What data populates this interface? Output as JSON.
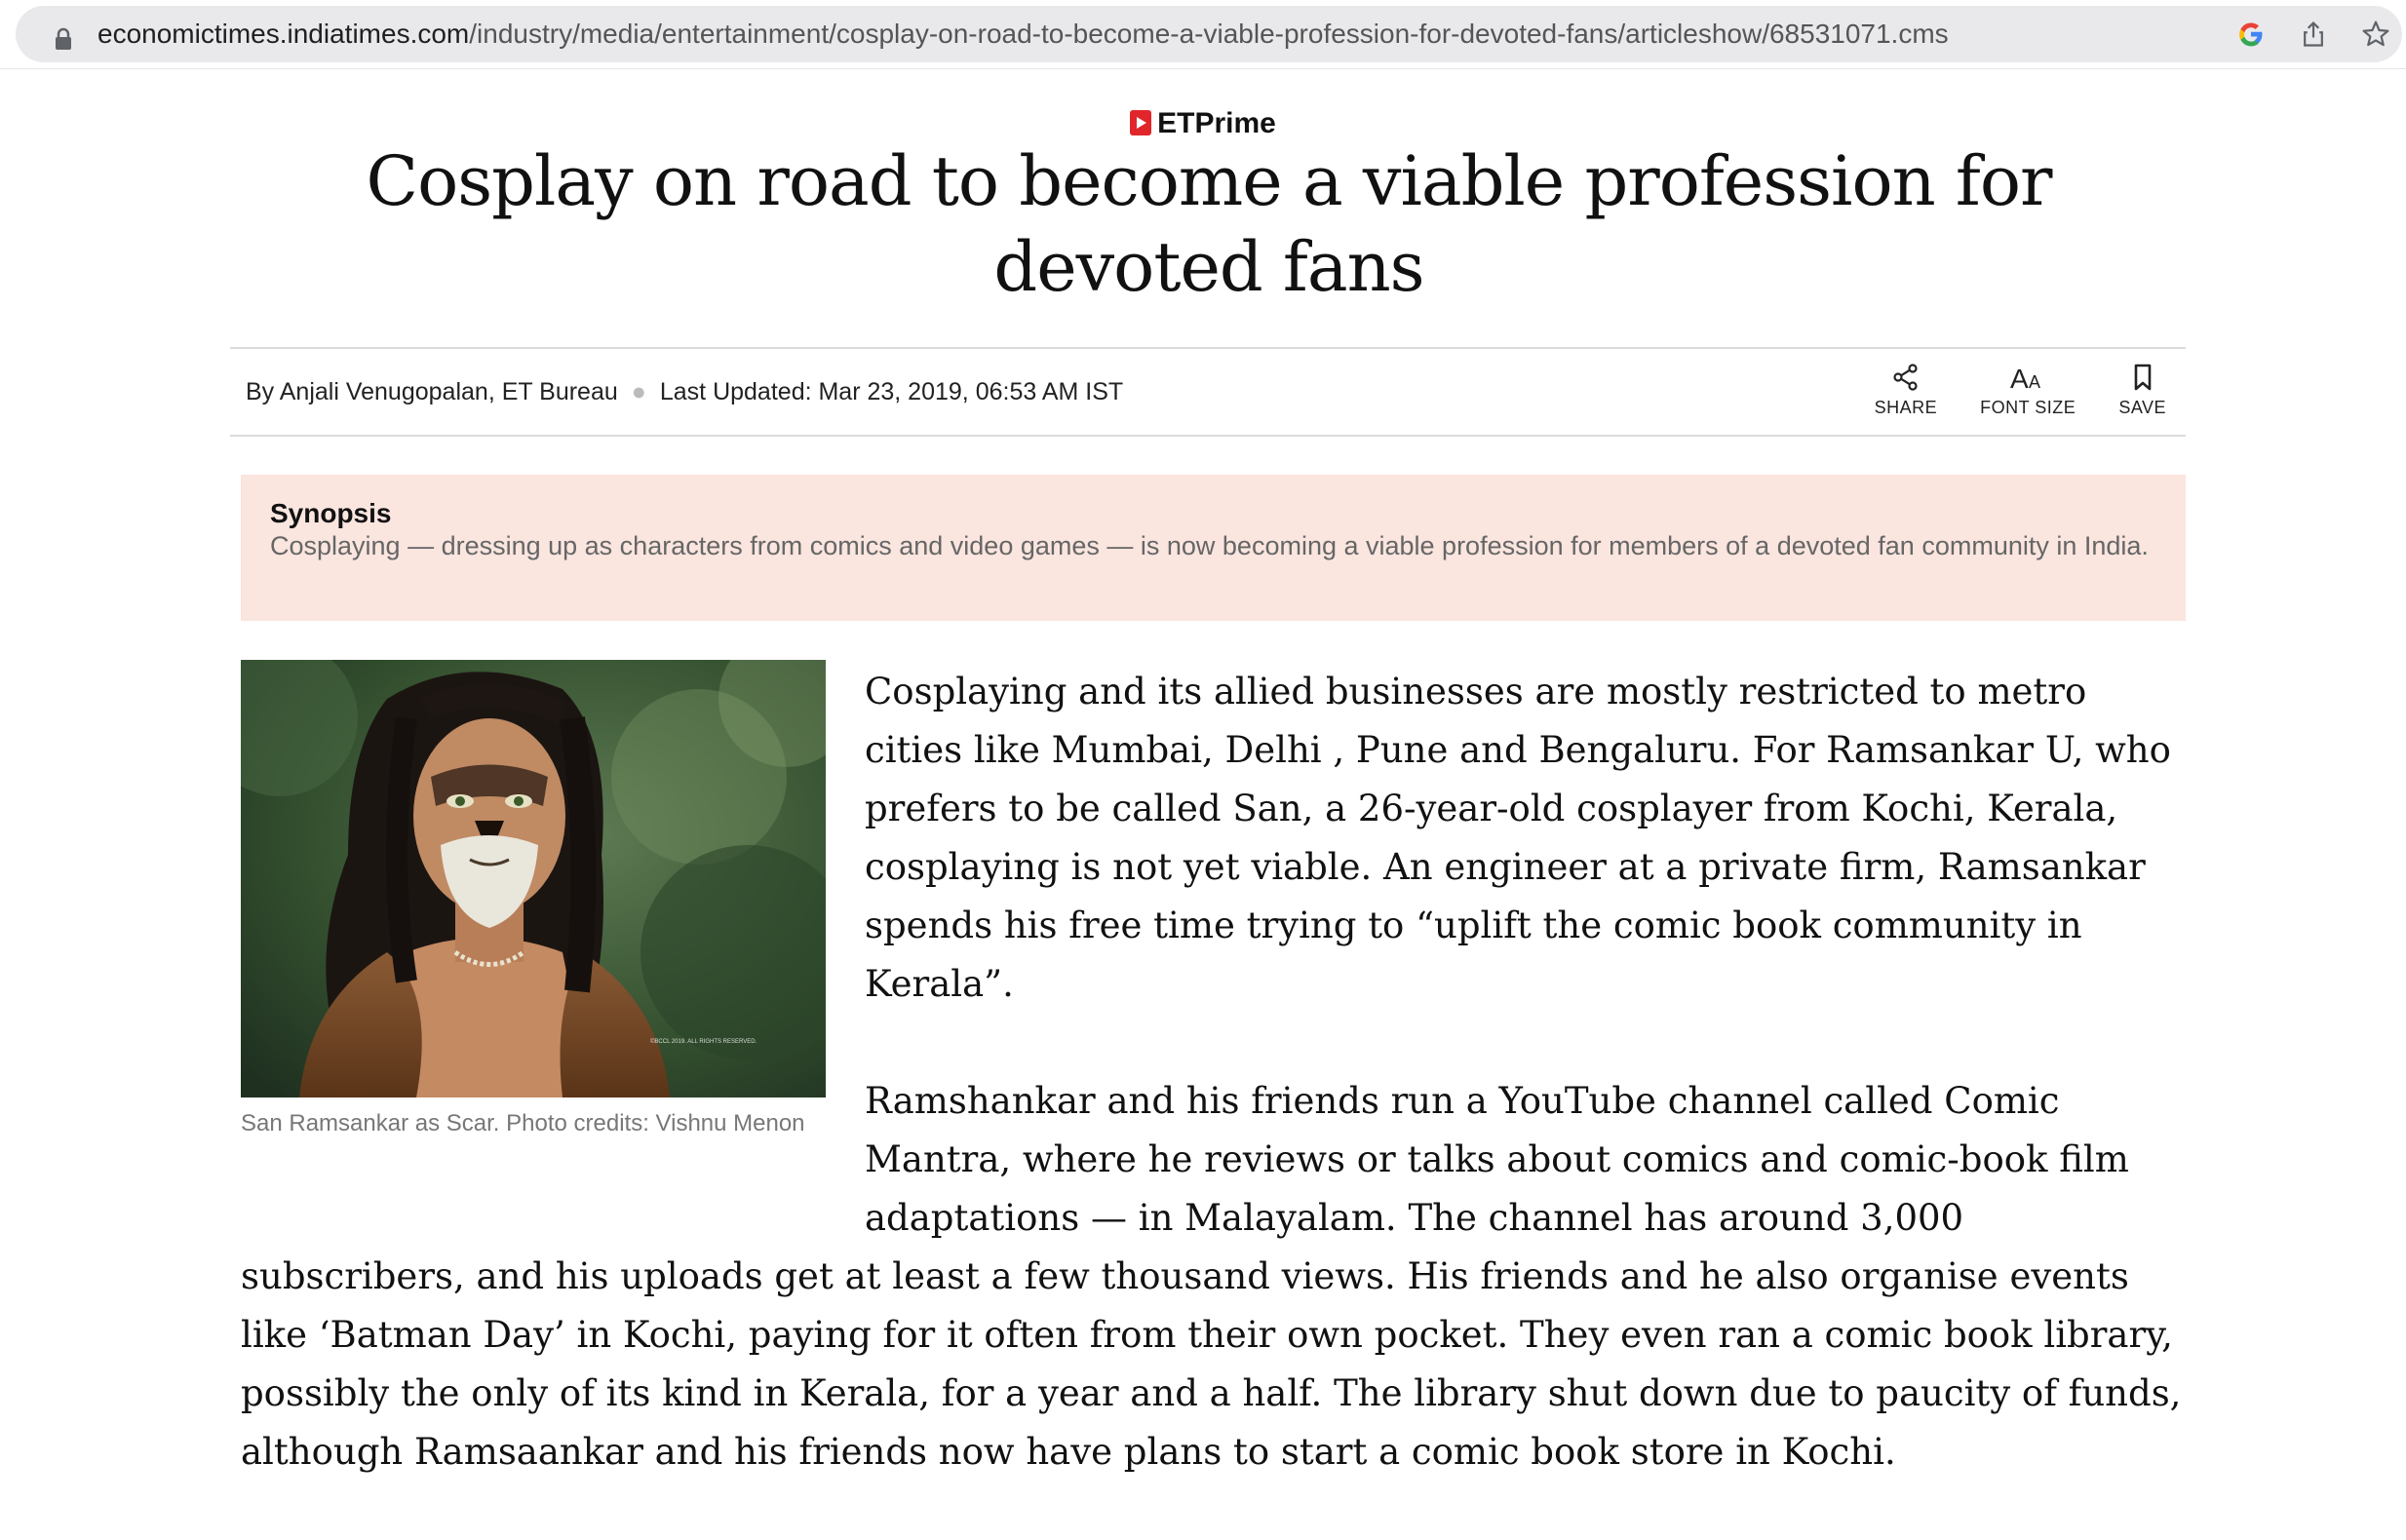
{
  "browser": {
    "url_domain": "economictimes.indiatimes.com",
    "url_path": "/industry/media/entertainment/cosplay-on-road-to-become-a-viable-profession-for-devoted-fans/articleshow/68531071.cms"
  },
  "article": {
    "kicker": "ETPrime",
    "headline": "Cosplay on road to become a viable profession for devoted fans",
    "byline": "By Anjali Venugopalan, ET Bureau",
    "updated": "Last Updated: Mar 23, 2019, 06:53 AM IST",
    "actions": {
      "share": "SHARE",
      "font_size": "FONT SIZE",
      "save": "SAVE"
    },
    "synopsis": {
      "title": "Synopsis",
      "text": "Cosplaying — dressing up as characters from comics and video games — is now becoming a viable profession for members of a devoted fan community in India."
    },
    "image": {
      "caption": "San Ramsankar as Scar. Photo credits: Vishnu Menon",
      "watermark": "©BCCL 2019. ALL RIGHTS RESERVED."
    },
    "paragraphs": [
      "Cosplaying and its allied businesses are mostly restricted to metro cities like Mumbai, Delhi , Pune and Bengaluru. For Ramsankar U, who prefers to be called San, a 26-year-old cosplayer from Kochi, Kerala, cosplaying is not yet viable. An engineer at a private firm, Ramsankar spends his free time trying to “uplift the comic book community in Kerala”.",
      "Ramshankar and his friends run a YouTube channel called Comic Mantra, where he reviews or talks about comics and comic-book film adaptations — in Malayalam. The channel has around 3,000 subscribers, and his uploads get at least a few thousand views. His friends and he also organise events like ‘Batman Day’ in Kochi, paying for it often from their own pocket. They even ran a comic book library, possibly the only of its kind in Kerala, for a year and a half. The library shut down due to paucity of funds, although Ramsaankar and his friends now have plans to start a comic book store in Kochi."
    ]
  }
}
